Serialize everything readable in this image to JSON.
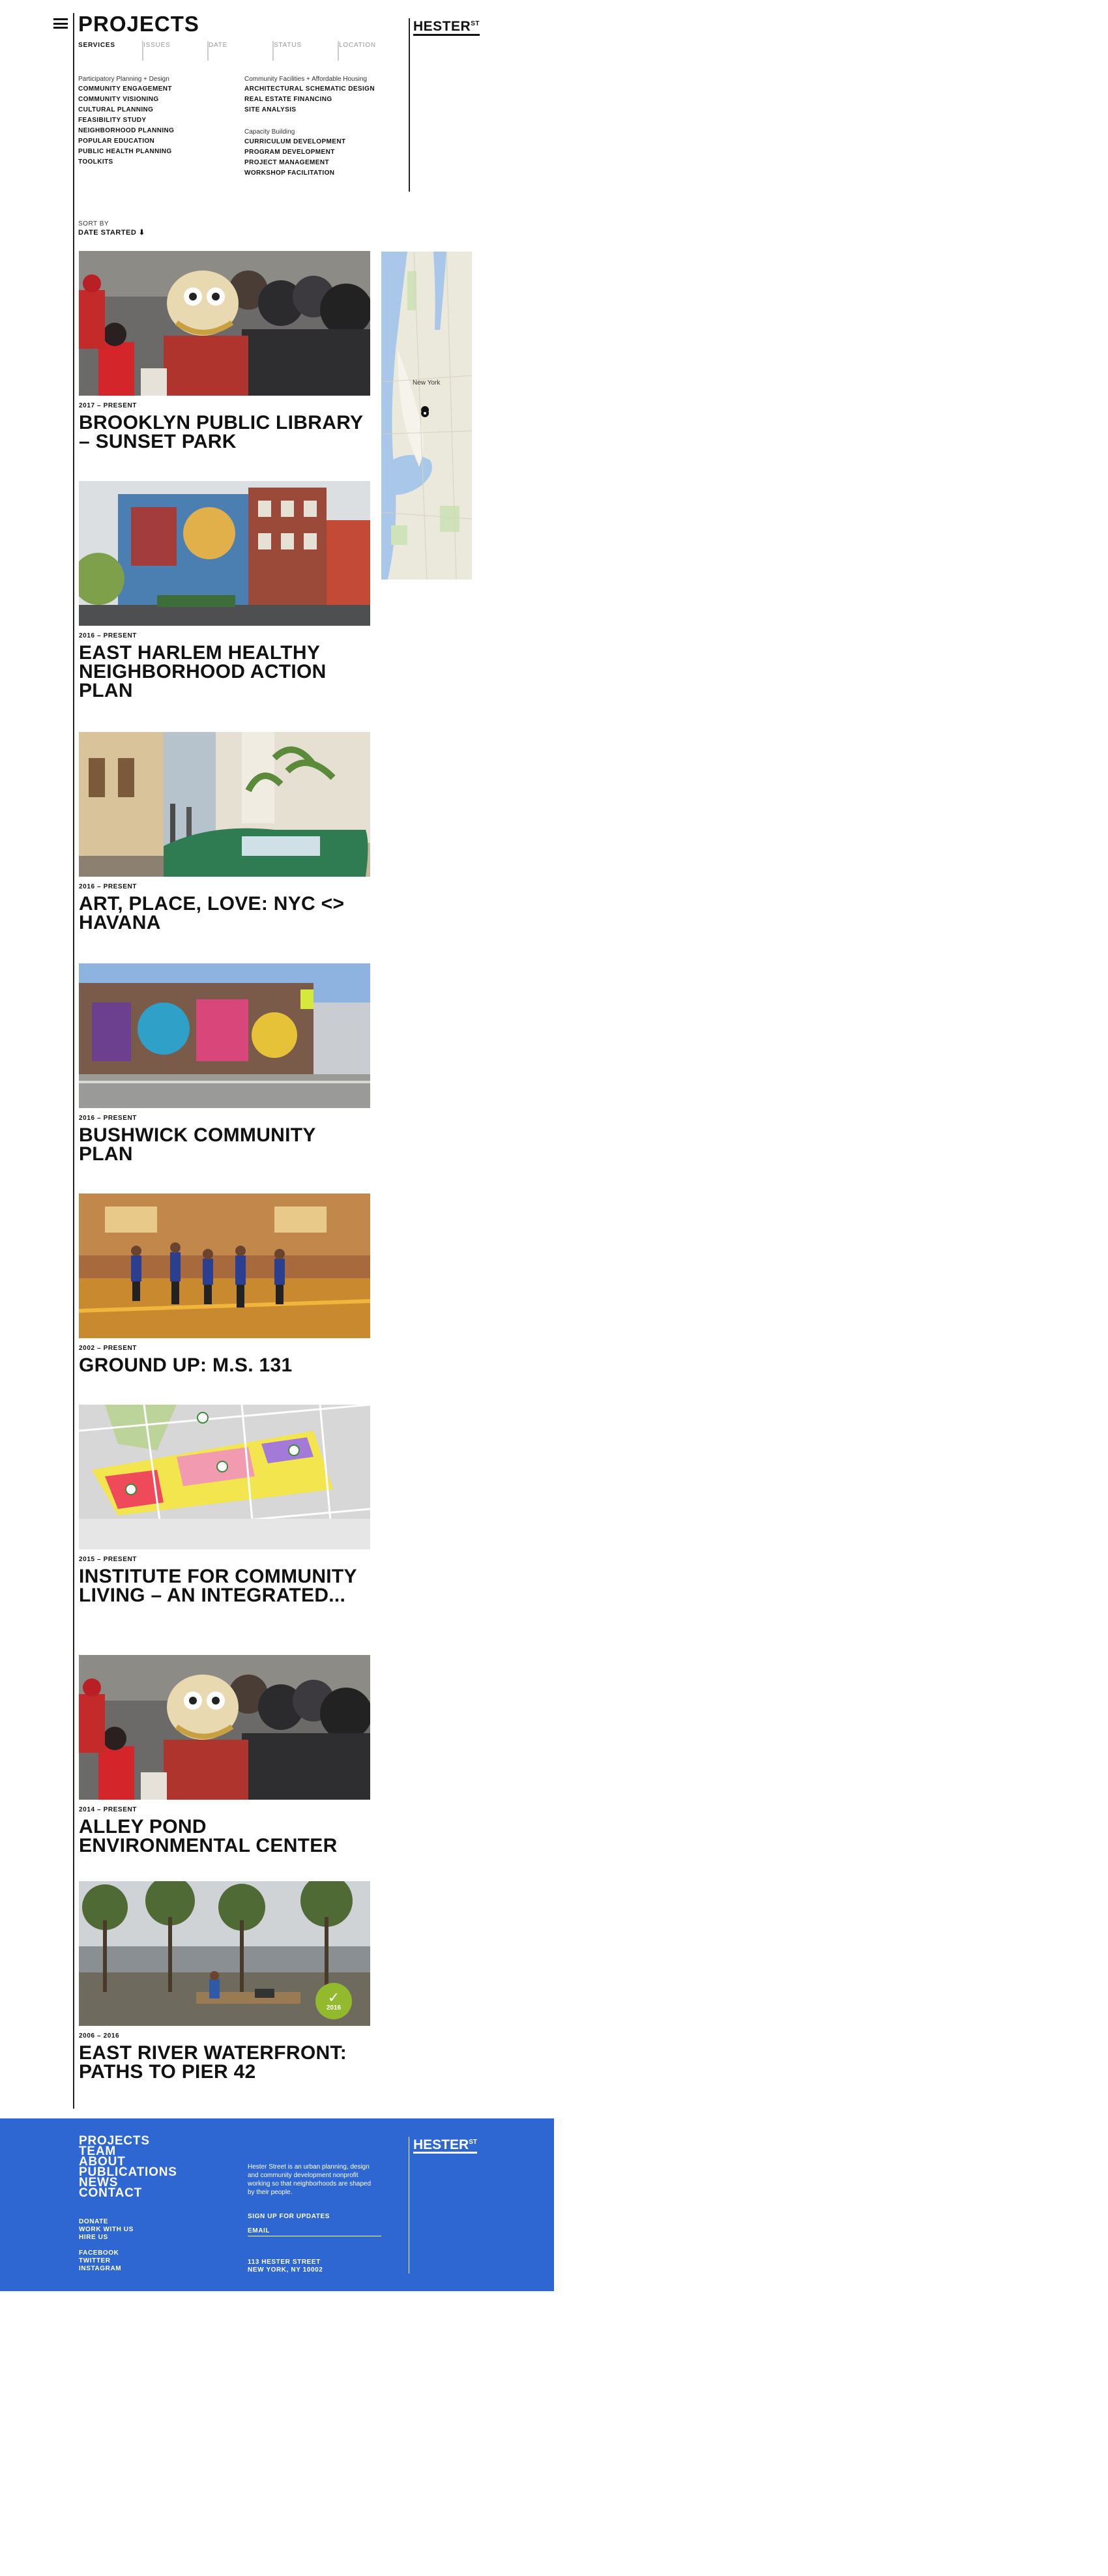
{
  "header": {
    "title": "PROJECTS",
    "logo_text": "HESTER",
    "logo_sup": "ST"
  },
  "filters": {
    "tabs": [
      "SERVICES",
      "ISSUES",
      "DATE",
      "STATUS",
      "LOCATION"
    ]
  },
  "services": {
    "left": [
      {
        "heading": "Participatory Planning + Design",
        "items": [
          "COMMUNITY ENGAGEMENT",
          "COMMUNITY VISIONING",
          "CULTURAL PLANNING",
          "FEASIBILITY STUDY",
          "NEIGHBORHOOD PLANNING",
          "POPULAR EDUCATION",
          "PUBLIC HEALTH PLANNING",
          "TOOLKITS"
        ]
      }
    ],
    "right": [
      {
        "heading": "Community Facilities + Affordable Housing",
        "items": [
          "ARCHITECTURAL SCHEMATIC DESIGN",
          "REAL ESTATE FINANCING",
          "SITE ANALYSIS"
        ]
      },
      {
        "heading": "Capacity Building",
        "items": [
          "CURRICULUM DEVELOPMENT",
          "PROGRAM DEVELOPMENT",
          "PROJECT MANAGEMENT",
          "WORKSHOP FACILITATION"
        ]
      }
    ]
  },
  "sort": {
    "label": "SORT BY",
    "value": "DATE STARTED ⬇"
  },
  "map": {
    "city_label": "New York"
  },
  "projects": [
    {
      "date": "2017 – PRESENT",
      "title": "BROOKLYN PUBLIC LIBRARY – SUNSET PARK"
    },
    {
      "date": "2016 – PRESENT",
      "title": "EAST HARLEM HEALTHY NEIGHBORHOOD ACTION PLAN"
    },
    {
      "date": "2016 – PRESENT",
      "title": "ART, PLACE, LOVE: NYC <> HAVANA"
    },
    {
      "date": "2016 – PRESENT",
      "title": "BUSHWICK COMMUNITY PLAN"
    },
    {
      "date": "2002 – PRESENT",
      "title": "GROUND UP: M.S. 131"
    },
    {
      "date": "2015 – PRESENT",
      "title": "INSTITUTE FOR COMMUNITY LIVING – AN INTEGRATED..."
    },
    {
      "date": "2014 – PRESENT",
      "title": "ALLEY POND ENVIRONMENTAL CENTER"
    },
    {
      "date": "2006 – 2016",
      "title": "EAST RIVER WATERFRONT: PATHS TO PIER 42",
      "badge": {
        "check": "✓",
        "year": "2016"
      }
    }
  ],
  "footer": {
    "nav": [
      "PROJECTS",
      "TEAM",
      "ABOUT",
      "PUBLICATIONS",
      "NEWS",
      "CONTACT"
    ],
    "links_1": [
      "DONATE",
      "WORK WITH US",
      "HIRE US"
    ],
    "links_2": [
      "FACEBOOK",
      "TWITTER",
      "INSTAGRAM"
    ],
    "about": "Hester Street is an urban planning, design and community development nonprofit working so that neighborhoods are shaped by their people.",
    "signup": "SIGN UP FOR UPDATES",
    "email_label": "EMAIL",
    "address_line1": "113 HESTER STREET",
    "address_line2": "NEW YORK, NY 10002",
    "logo_text": "HESTER",
    "logo_sup": "ST"
  }
}
